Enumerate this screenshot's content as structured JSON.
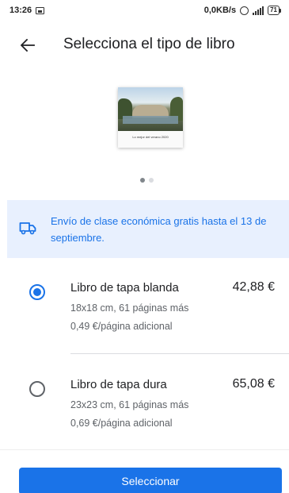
{
  "status_bar": {
    "time": "13:26",
    "network_speed": "0,0KB/s",
    "signal_label": "4G",
    "battery": "71"
  },
  "header": {
    "title": "Selecciona el tipo de libro",
    "back_icon": "arrow-back-icon"
  },
  "preview": {
    "caption": "Lo mejor del verano 2020",
    "icon": "book-cover-image"
  },
  "carousel": {
    "total_pages": 2,
    "current_page": 1,
    "active_color": "#80868b",
    "inactive_color": "#dadce0"
  },
  "shipping": {
    "icon": "truck-icon",
    "text": "Envío de clase económica gratis hasta el 13 de septiembre."
  },
  "options": [
    {
      "title": "Libro de tapa blanda",
      "price": "42,88 €",
      "size_pages": "18x18 cm, 61 páginas más",
      "extra_page": "0,49 €/página adicional",
      "selected": true
    },
    {
      "title": "Libro de tapa dura",
      "price": "65,08 €",
      "size_pages": "23x23 cm, 61 páginas más",
      "extra_page": "0,69 €/página adicional",
      "selected": false
    }
  ],
  "actions": {
    "select_label": "Seleccionar"
  },
  "colors": {
    "accent": "#1a73e8",
    "banner_bg": "#e8f0fe"
  }
}
